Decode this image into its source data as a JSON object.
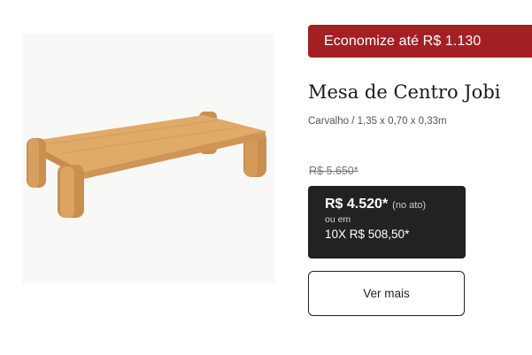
{
  "colors": {
    "banner_bg": "#a31f24",
    "price_box_bg": "#222222",
    "wood_light": "#dba463",
    "wood_dark": "#c98f4f"
  },
  "banner": {
    "text": "Economize até R$ 1.130"
  },
  "product": {
    "image_icon": "coffee-table-image",
    "name": "Mesa de Centro Jobi",
    "specs": "Carvalho / 1,35 x 0,70 x 0,33m",
    "old_price": "R$ 5.650*",
    "price": "R$ 4.520*",
    "price_note": "(no ato)",
    "installment_prefix": "ou em",
    "installment": "10X R$ 508,50*"
  },
  "actions": {
    "see_more_label": "Ver mais"
  }
}
